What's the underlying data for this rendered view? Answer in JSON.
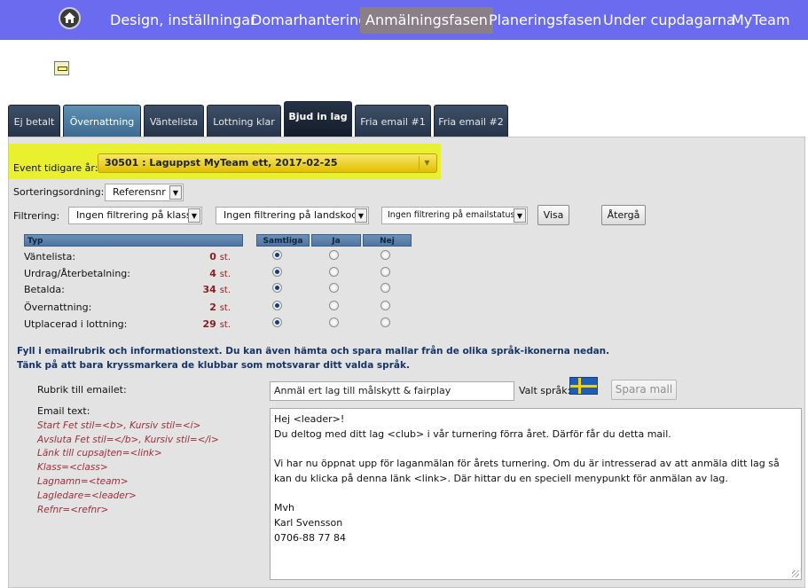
{
  "nav": {
    "items": [
      "Design, inställningar",
      "Domarhantering",
      "Anmälningsfasen",
      "Planeringsfasen",
      "Under cupdagarna",
      "MyTeam"
    ],
    "active": "Anmälningsfasen"
  },
  "tabs": [
    "Ej betalt",
    "Övernattning",
    "Väntelista",
    "Lottning klar",
    "Bjud in lag",
    "Fria email #1",
    "Fria email #2"
  ],
  "selected_tab": "Bjud in lag",
  "event": {
    "label": "Event tidigare år:",
    "value": "30501 : Laguppst MyTeam ett, 2017-02-25"
  },
  "sort": {
    "label": "Sorteringsordning:",
    "value": "Referensnr"
  },
  "filter": {
    "label": "Filtrering:",
    "class": "Ingen filtrering på klass",
    "country": "Ingen filtrering på landskod",
    "email": "Ingen filtrering på emailstatus",
    "show_button": "Visa",
    "back_button": "Återgå"
  },
  "table": {
    "headers": [
      "Typ",
      "Samtliga",
      "Ja",
      "Nej"
    ],
    "unit": "st.",
    "rows": [
      {
        "label": "Väntelista:",
        "count": "0",
        "selected": "Samtliga"
      },
      {
        "label": "Urdrag/Återbetalning:",
        "count": "4",
        "selected": "Samtliga"
      },
      {
        "label": "Betalda:",
        "count": "34",
        "selected": "Samtliga"
      },
      {
        "label": "Övernattning:",
        "count": "2",
        "selected": "Samtliga"
      },
      {
        "label": "Utplacerad i lottning:",
        "count": "29",
        "selected": "Samtliga"
      }
    ]
  },
  "instructions": [
    "Fyll i emailrubrik och informationstext. Du kan även hämta och spara mallar från de olika språk-ikonerna nedan.",
    "Tänk på att bara kryssmarkera de klubbar som motsvarar ditt valda språk."
  ],
  "subject": {
    "label": "Rubrik till emailet:",
    "value": "Anmäl ert lag till målskytt & fairplay"
  },
  "language": {
    "label": "Valt språk:",
    "flag": "swedish-flag"
  },
  "save_template_button": "Spara mall",
  "email": {
    "label": "Email text:",
    "codes": [
      "Start Fet stil=<b>, Kursiv stil=<i>",
      "Avsluta Fet stil=</b>, Kursiv stil=</i>",
      "Länk till cupsajten=<link>",
      "Klass=<class>",
      "Lagnamn=<team>",
      "Lagledare=<leader>",
      "Refnr=<refnr>"
    ],
    "body_lines": [
      "Hej <leader>!",
      "Du deltog med ditt lag <club>  i vår turnering förra året. Därför får du detta mail.",
      "",
      "Vi har nu öppnat upp för laganmälan för årets turnering. Om du är intresserad av att anmäla ditt lag så",
      "kan du klicka på denna länk <link>. Där hittar du en speciell menypunkt för anmälan av lag.",
      "",
      "Mvh",
      "Karl Svensson",
      "0706-88 77 84"
    ]
  }
}
